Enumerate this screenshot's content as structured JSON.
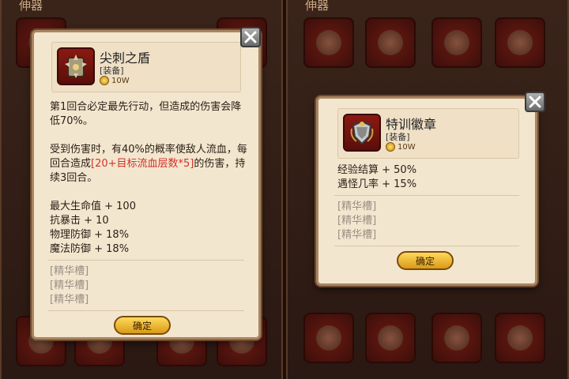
{
  "left_panel": {
    "title": "伸器"
  },
  "right_panel": {
    "title": "伸器"
  },
  "item_left": {
    "name": "尖刺之盾",
    "type": "[装备]",
    "price": "10W",
    "effect1": "第1回合必定最先行动，但造成的伤害会降低70%。",
    "effect2_pre": "受到伤害时，有40%的概率使敌人流血，每回合造成",
    "effect2_red": "[20+目标流血层数*5]",
    "effect2_post": "的伤害，持续3回合。",
    "stats": [
      "最大生命值 + 100",
      "抗暴击 + 10",
      "物理防御 + 18%",
      "魔法防御 + 18%"
    ],
    "slots": [
      "[精华槽]",
      "[精华槽]",
      "[精华槽]"
    ],
    "confirm": "确定"
  },
  "item_right": {
    "name": "特训徽章",
    "type": "[装备]",
    "price": "10W",
    "stats": [
      "经验结算 + 50%",
      "遇怪几率 + 15%"
    ],
    "slots": [
      "[精华槽]",
      "[精华槽]",
      "[精华槽]"
    ],
    "confirm": "确定"
  },
  "colors": {
    "highlight": "#d2322a",
    "card_bg": "#f3e6cf",
    "button": "#f0b830"
  }
}
